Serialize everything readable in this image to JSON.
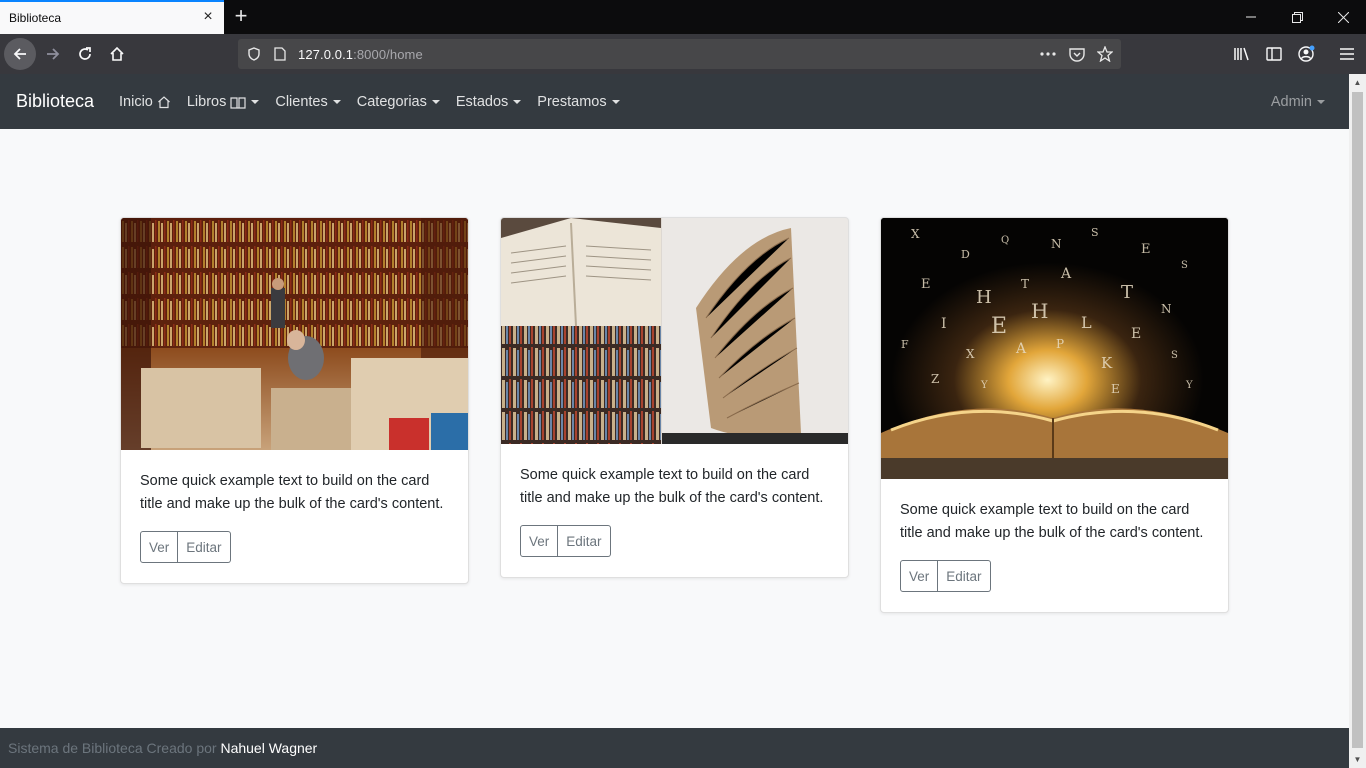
{
  "browser": {
    "tab_title": "Biblioteca",
    "url_host": "127.0.0.1",
    "url_rest": ":8000/home"
  },
  "nav": {
    "brand": "Biblioteca",
    "items": [
      {
        "label": "Inicio",
        "icon": "home-icon",
        "dropdown": false
      },
      {
        "label": "Libros",
        "icon": "book-icon",
        "dropdown": true
      },
      {
        "label": "Clientes",
        "dropdown": true
      },
      {
        "label": "Categorias",
        "dropdown": true
      },
      {
        "label": "Estados",
        "dropdown": true
      },
      {
        "label": "Prestamos",
        "dropdown": true
      }
    ],
    "user": "Admin"
  },
  "cards": [
    {
      "image": "bookstore-photo",
      "text": "Some quick example text to build on the card title and make up the bulk of the card's content.",
      "view_label": "Ver",
      "edit_label": "Editar"
    },
    {
      "image": "open-books-collage",
      "text": "Some quick example text to build on the card title and make up the bulk of the card's content.",
      "view_label": "Ver",
      "edit_label": "Editar"
    },
    {
      "image": "glowing-book-letters",
      "text": "Some quick example text to build on the card title and make up the bulk of the card's content.",
      "view_label": "Ver",
      "edit_label": "Editar"
    }
  ],
  "footer": {
    "text": "Sistema de Biblioteca Creado por ",
    "author": "Nahuel Wagner"
  },
  "colors": {
    "navbar": "#343a40",
    "page_bg": "#f8f9fa",
    "button_outline": "#6c757d",
    "tab_accent": "#0a84ff"
  }
}
